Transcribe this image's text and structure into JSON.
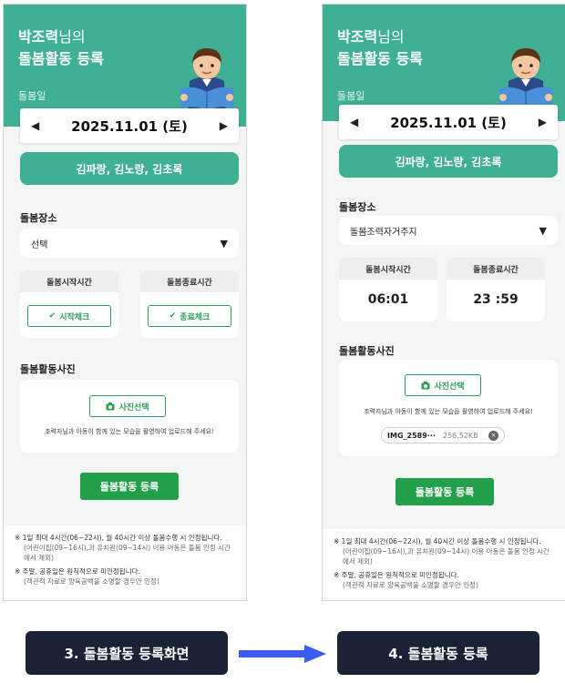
{
  "colors": {
    "header_green": "#3fb093",
    "button_green": "#22a14a",
    "caption_navy": "#1a2236",
    "arrow_blue": "#3a5cf0"
  },
  "screen_left": {
    "title_name": "박조력",
    "title_suffix": "님의",
    "title_main": "돌봄활동 등록",
    "date_label": "돌봄일",
    "prev_arrow": "◀",
    "date": "2025.11.01 (토)",
    "next_arrow": "▶",
    "caregivers": "김파랑, 김노랑, 김초록",
    "place_label": "돌봄장소",
    "place_value": "선택",
    "caret": "▼",
    "start_label": "돌봄시작시간",
    "end_label": "돌봄종료시간",
    "start_button": "시작체크",
    "end_button": "종료체크",
    "check_icon": "✔",
    "photo_label": "돌봄활동사진",
    "photo_button": "사진선택",
    "photo_help": "조력자님과 아동이 함께 있는 모습을 촬영하여 업로드해 주세요!",
    "submit": "돌봄활동 등록",
    "notes": [
      {
        "type": "main",
        "text": "※ 1일 최대 4시간(06~22시), 월 40시간 이상 돌봄수행 시 인정됩니다."
      },
      {
        "type": "sub",
        "text": "(어린이집(09~16시),과 유치원(09~14시) 이용 아동은 돌봄 인정 시간에서 제외)"
      },
      {
        "type": "main",
        "text": "※ 주말, 공휴일은 원칙적으로 미인정됩니다."
      },
      {
        "type": "sub",
        "text": "(객관적 자료로 양육공백을 소명할 경우만 인정)"
      }
    ]
  },
  "screen_right": {
    "title_name": "박조력",
    "title_suffix": "님의",
    "title_main": "돌봄활동 등록",
    "date_label": "돌봄일",
    "prev_arrow": "◀",
    "date": "2025.11.01 (토)",
    "next_arrow": "▶",
    "caregivers": "김파랑, 김노랑, 김초록",
    "place_label": "돌봄장소",
    "place_value": "돌봄조력자거주지",
    "caret": "▼",
    "start_label": "돌봄시작시간",
    "end_label": "돌봄종료시간",
    "start_time": "06:01",
    "end_time": "23 :59",
    "photo_label": "돌봄활동사진",
    "photo_button": "사진선택",
    "photo_help": "조력자님과 아동이 함께 있는 모습을 촬영하여 업로드해 주세요!",
    "file_name": "IMG_2589···",
    "file_size": "256.52KB",
    "file_remove": "×",
    "submit": "돌봄활동 등록",
    "notes": [
      {
        "type": "main",
        "text": "※ 1일 최대 4시간(06~22시), 월 40시간 이상 돌봄수행 시 인정됩니다."
      },
      {
        "type": "sub",
        "text": "(어린이집(09~16시),과 유치원(09~14시) 이용 아동은 돌봄 인정 시간에서 제외)"
      },
      {
        "type": "main",
        "text": "※ 주말, 공휴일은 원칙적으로 미인정됩니다."
      },
      {
        "type": "sub",
        "text": "(객관적 자료로 양육공백을 소명할 경우만 인정)"
      }
    ]
  },
  "captions": {
    "left": "3. 돌봄활동 등록화면",
    "right": "4. 돌봄활동 등록"
  }
}
